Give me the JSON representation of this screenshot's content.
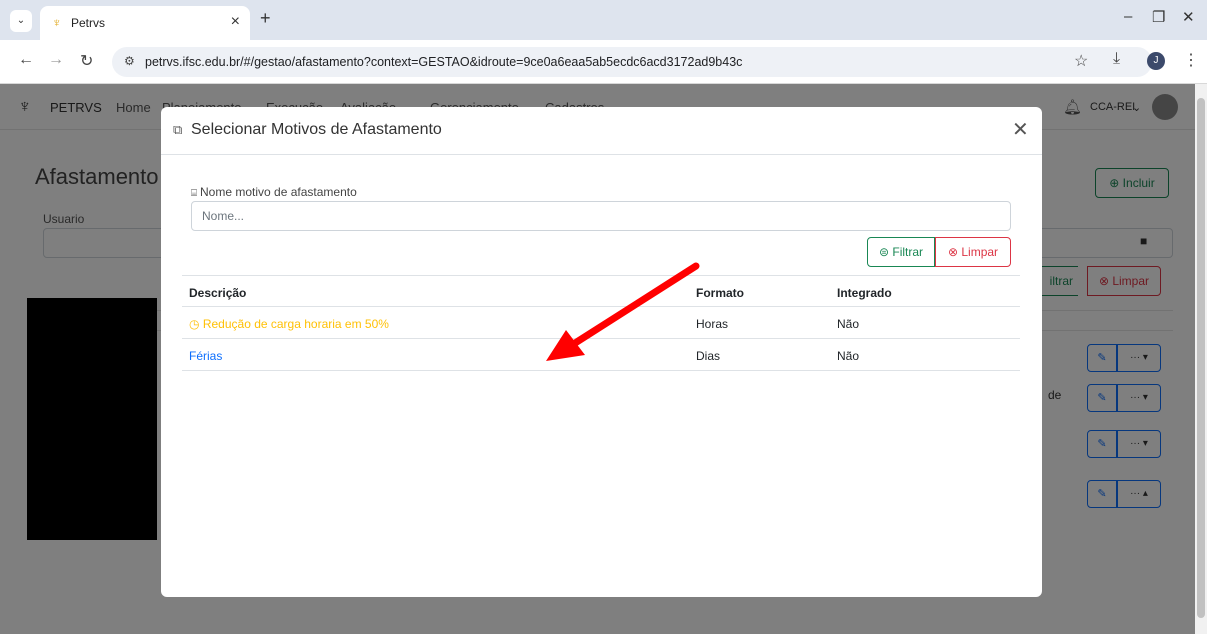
{
  "browser": {
    "tab_title": "Petrvs",
    "tab_close": "×",
    "new_tab": "+",
    "url": "petrvs.ifsc.edu.br/#/gestao/afastamento?context=GESTAO&idroute=9ce0a6eaa5ab5ecdc6acd3172ad9b43c",
    "profile_initial": "J",
    "minimize": "–",
    "restore": "❐",
    "close": "✕"
  },
  "app": {
    "brand": "PETRVS",
    "nav": [
      "Home",
      "Planejamento",
      "Execução",
      "Avaliação",
      "Gerenciamento",
      "Cadastros"
    ],
    "unit": "CCA-REI",
    "page_title": "Afastamento",
    "incluir_label": "⊕ Incluir",
    "usuario_label": "Usuario",
    "filtrar_label": "iltrar",
    "limpar_label": "⊗ Limpar",
    "de_text": "de"
  },
  "modal": {
    "title": "Selecionar Motivos de Afastamento",
    "field_label": "Nome motivo de afastamento",
    "field_placeholder": "Nome...",
    "filtrar_label": "Filtrar",
    "limpar_label": "Limpar",
    "columns": {
      "descricao": "Descrição",
      "formato": "Formato",
      "integrado": "Integrado"
    },
    "rows": [
      {
        "descricao": "Redução de carga horaria em 50%",
        "formato": "Horas",
        "integrado": "Não"
      },
      {
        "descricao": "Férias",
        "formato": "Dias",
        "integrado": "Não"
      }
    ]
  },
  "colors": {
    "success": "#198754",
    "danger": "#dc3545",
    "warning": "#ffc107",
    "primary": "#0d6efd",
    "annotation_arrow": "#ff0000"
  }
}
